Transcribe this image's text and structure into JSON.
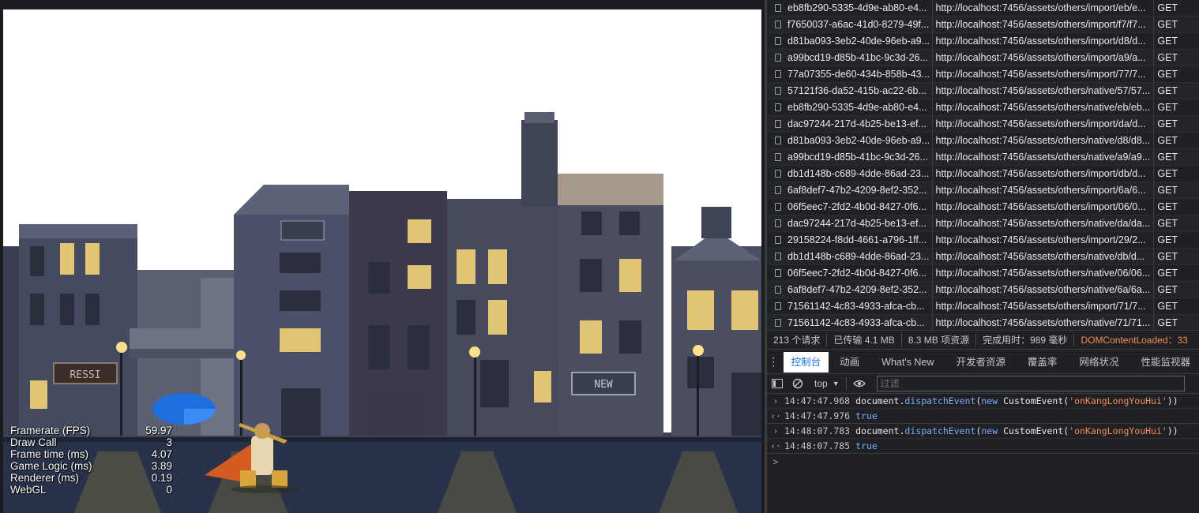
{
  "game": {
    "stats": [
      {
        "label": "Framerate (FPS)",
        "value": "59.97"
      },
      {
        "label": "Draw Call",
        "value": "3"
      },
      {
        "label": "Frame time (ms)",
        "value": "4.07"
      },
      {
        "label": "Game Logic (ms)",
        "value": "3.89"
      },
      {
        "label": "Renderer (ms)",
        "value": "0.19"
      },
      {
        "label": "WebGL",
        "value": "0"
      }
    ],
    "shop_signs": [
      "RESSI",
      "NEW"
    ]
  },
  "network": {
    "rows": [
      {
        "name": "eb8fb290-5335-4d9e-ab80-e4...",
        "url": "http://localhost:7456/assets/others/import/eb/e...",
        "method": "GET"
      },
      {
        "name": "f7650037-a6ac-41d0-8279-49f...",
        "url": "http://localhost:7456/assets/others/import/f7/f7...",
        "method": "GET"
      },
      {
        "name": "d81ba093-3eb2-40de-96eb-a9...",
        "url": "http://localhost:7456/assets/others/import/d8/d...",
        "method": "GET"
      },
      {
        "name": "a99bcd19-d85b-41bc-9c3d-26...",
        "url": "http://localhost:7456/assets/others/import/a9/a...",
        "method": "GET"
      },
      {
        "name": "77a07355-de60-434b-858b-43...",
        "url": "http://localhost:7456/assets/others/import/77/7...",
        "method": "GET"
      },
      {
        "name": "57121f36-da52-415b-ac22-6b...",
        "url": "http://localhost:7456/assets/others/native/57/57...",
        "method": "GET"
      },
      {
        "name": "eb8fb290-5335-4d9e-ab80-e4...",
        "url": "http://localhost:7456/assets/others/native/eb/eb...",
        "method": "GET"
      },
      {
        "name": "dac97244-217d-4b25-be13-ef...",
        "url": "http://localhost:7456/assets/others/import/da/d...",
        "method": "GET"
      },
      {
        "name": "d81ba093-3eb2-40de-96eb-a9...",
        "url": "http://localhost:7456/assets/others/native/d8/d8...",
        "method": "GET"
      },
      {
        "name": "a99bcd19-d85b-41bc-9c3d-26...",
        "url": "http://localhost:7456/assets/others/native/a9/a9...",
        "method": "GET"
      },
      {
        "name": "db1d148b-c689-4dde-86ad-23...",
        "url": "http://localhost:7456/assets/others/import/db/d...",
        "method": "GET"
      },
      {
        "name": "6af8def7-47b2-4209-8ef2-352...",
        "url": "http://localhost:7456/assets/others/import/6a/6...",
        "method": "GET"
      },
      {
        "name": "06f5eec7-2fd2-4b0d-8427-0f6...",
        "url": "http://localhost:7456/assets/others/import/06/0...",
        "method": "GET"
      },
      {
        "name": "dac97244-217d-4b25-be13-ef...",
        "url": "http://localhost:7456/assets/others/native/da/da...",
        "method": "GET"
      },
      {
        "name": "29158224-f8dd-4661-a796-1ff...",
        "url": "http://localhost:7456/assets/others/import/29/2...",
        "method": "GET"
      },
      {
        "name": "db1d148b-c689-4dde-86ad-23...",
        "url": "http://localhost:7456/assets/others/native/db/d...",
        "method": "GET"
      },
      {
        "name": "06f5eec7-2fd2-4b0d-8427-0f6...",
        "url": "http://localhost:7456/assets/others/native/06/06...",
        "method": "GET"
      },
      {
        "name": "6af8def7-47b2-4209-8ef2-352...",
        "url": "http://localhost:7456/assets/others/native/6a/6a...",
        "method": "GET"
      },
      {
        "name": "71561142-4c83-4933-afca-cb...",
        "url": "http://localhost:7456/assets/others/import/71/7...",
        "method": "GET"
      },
      {
        "name": "71561142-4c83-4933-afca-cb...",
        "url": "http://localhost:7456/assets/others/native/71/71...",
        "method": "GET"
      }
    ],
    "summary": {
      "requests": "213 个请求",
      "transferred": "已传输 4.1 MB",
      "resources": "8.3 MB 项资源",
      "finish": "完成用时：989 毫秒",
      "dcl": "DOMContentLoaded：33"
    }
  },
  "drawer": {
    "tabs": [
      "控制台",
      "动画",
      "What's New",
      "开发者资源",
      "覆盖率",
      "网络状况",
      "性能监视器"
    ],
    "context": "top",
    "filter_placeholder": "过滤"
  },
  "console": {
    "entries": [
      {
        "time": "14:47:47.968",
        "obj": "document",
        "method": "dispatchEvent",
        "kw": "new",
        "ctor": "CustomEvent",
        "arg": "'onKangLongYouHui'",
        "result_time": "14:47:47.976",
        "result": "true"
      },
      {
        "time": "14:48:07.783",
        "obj": "document",
        "method": "dispatchEvent",
        "kw": "new",
        "ctor": "CustomEvent",
        "arg": "'onKangLongYouHui'",
        "result_time": "14:48:07.785",
        "result": "true"
      }
    ],
    "prompt": ">"
  },
  "colors": {
    "accent": "#1a73e8",
    "dcl": "#f28b54",
    "keyword": "#7cacf8"
  }
}
